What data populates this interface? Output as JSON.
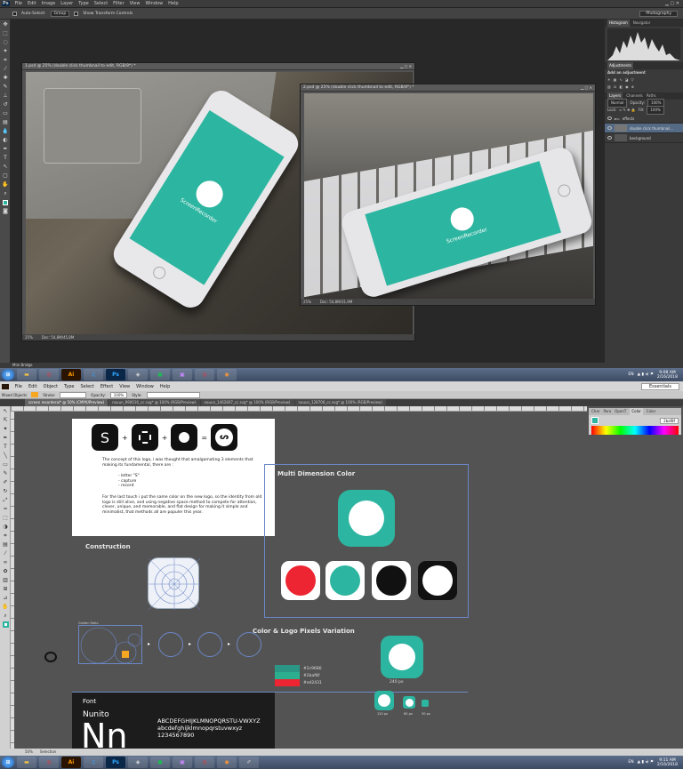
{
  "photoshop": {
    "menu": [
      "File",
      "Edit",
      "Image",
      "Layer",
      "Type",
      "Select",
      "Filter",
      "View",
      "Window",
      "Help"
    ],
    "options": {
      "auto_select": "Auto-Select:",
      "group": "Group",
      "transform": "Show Transform Controls",
      "workspace": "Photography"
    },
    "doc1": {
      "title": "1.psd @ 25% (double click thumbnail to edit, RGB/8*) *",
      "zoom": "25%",
      "doc": "Doc: 54,8M/45,8M"
    },
    "doc2": {
      "title": "2.psd @ 25% (double click thumbnail to edit, RGB/8*) *",
      "zoom": "25%",
      "doc": "Doc: 54,8M/31,9M"
    },
    "mockup_text": "ScreenRecorder",
    "mini_bridge": "Mini Bridge",
    "panels": {
      "histogram_tabs": [
        "Histogram",
        "Navigator"
      ],
      "adjust_tab": "Adjustments",
      "adjust_label": "Add an adjustment",
      "layers_tabs": [
        "Layers",
        "Channels",
        "Paths"
      ],
      "blend": "Normal",
      "opacity_label": "Opacity:",
      "opacity": "100%",
      "lock": "Lock:",
      "fill_label": "Fill:",
      "fill": "100%",
      "layers": [
        "effects",
        "double click thumbnail...",
        "background"
      ]
    }
  },
  "taskbar_top": {
    "lang": "EN",
    "time": "9:08 AM",
    "date": "2/16/2018"
  },
  "taskbar_bottom": {
    "lang": "EN",
    "time": "9:11 AM",
    "date": "2/16/2018"
  },
  "illustrator": {
    "menu": [
      "File",
      "Edit",
      "Object",
      "Type",
      "Select",
      "Effect",
      "View",
      "Window",
      "Help"
    ],
    "workspace": "Essentials",
    "ctrl": {
      "mixed": "Mixed Objects",
      "stroke": "Stroke:",
      "opacity": "Opacity:",
      "opacity_val": "100%",
      "style": "Style:"
    },
    "tabs": [
      "screen recorderai* @ 50% (CMYK/Preview)",
      "nouun_990016_cc.svg* @ 100% (RGB/Preview)",
      "nouun_1462807_cc.svg* @ 100% (RGB/Preview)",
      "nouun_128706_cc.svg* @ 100% (RGB/Preview)"
    ],
    "color_tabs": [
      "Char",
      "Para",
      "OpenT",
      "Color",
      "Color"
    ],
    "hex": "2baf8f",
    "bottom_zoom": "50%",
    "bottom_mode": "Selection"
  },
  "design": {
    "concept_text": "The concept of this logo, i was thought that amalgamating 3 elements that making its fundamental, there are :",
    "bullets": [
      "- letter \"S\"",
      "- capture",
      "- record"
    ],
    "last_text": "For the last touch i put the same color on the new logo, so the identity from old logo is still alive, and using negative space method to compete for attention, clever, unique, and memorable, and flat design for making it simple and minimalist, that methods all are populer this year.",
    "construction": "Construction",
    "golden": "Golden Ratio",
    "multi": "Multi Dimension Color",
    "variation": "Color & Logo Pixels Variation",
    "hexes": [
      "#2c9686",
      "#2baf8f",
      "#ed2431"
    ],
    "sizes": [
      "240 px",
      "120 px",
      "60 px",
      "30 px"
    ],
    "font_label": "Font",
    "font_name": "Nunito",
    "upper": "ABCDEFGHIJKLMNOPQRSTU-VWXYZ",
    "lower": "abcdefghijklmnopqrstuvwxyz",
    "digits": "1234567890",
    "glyph": "Nn",
    "letter_s": "S"
  },
  "colors": {
    "teal": "#2cb5a0",
    "red": "#ed2431"
  }
}
